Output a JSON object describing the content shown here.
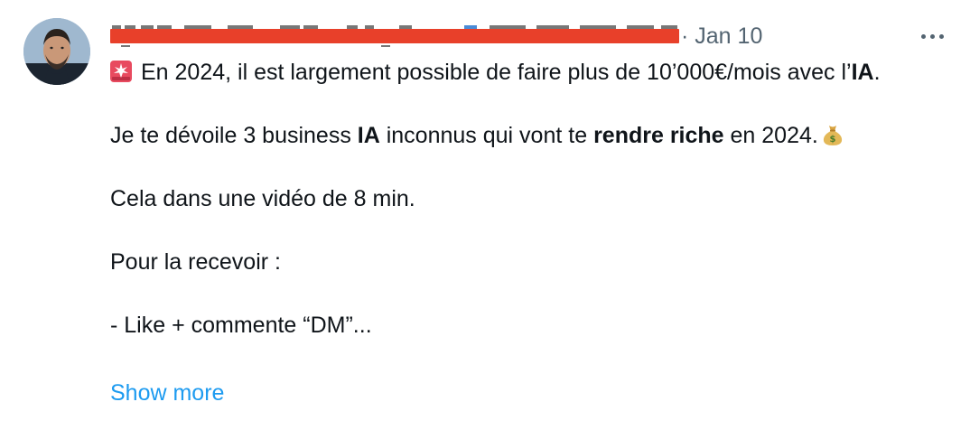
{
  "tweet": {
    "date": "Jan 10",
    "separator": "·",
    "more_icon": "more-horizontal-icon",
    "line1_text": "En 2024, il est largement possible de faire plus de 10’000€/mois avec l’",
    "line1_bold": "IA",
    "line1_end": ".",
    "p2_a": "Je te dévoile 3 business ",
    "p2_b": "IA",
    "p2_c": " inconnus qui vont te ",
    "p2_d": "rendre riche",
    "p2_e": " en 2024.",
    "p3": "Cela dans une vidéo de 8 min.",
    "p4": "Pour la recevoir :",
    "p5": "- Like + commente “DM”...",
    "show_more": "Show more",
    "icons": {
      "siren": "police-light-icon",
      "money_bag": "money-bag-icon"
    },
    "colors": {
      "redaction": "#e8402a",
      "link": "#1d9bf0",
      "muted": "#536471",
      "text": "#0f1419"
    }
  }
}
